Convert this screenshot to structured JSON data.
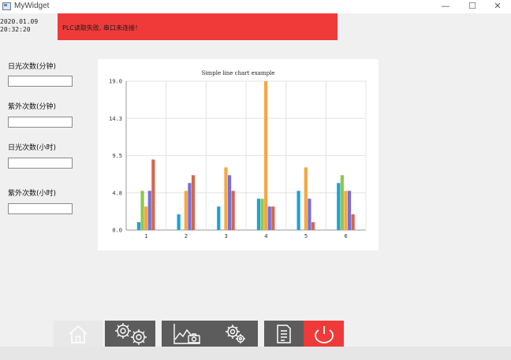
{
  "window": {
    "title": "MyWidget",
    "minimize_glyph": "—",
    "maximize_glyph": "☐",
    "close_glyph": "✕"
  },
  "clock": {
    "date": "2020.01.09",
    "time": "20:32:20"
  },
  "alert": {
    "message": "PLC读取失败, 串口未连接！",
    "color": "#f03a3a"
  },
  "fields": [
    {
      "label": "日光次数(分钟)",
      "value": ""
    },
    {
      "label": "紫外次数(分钟)",
      "value": ""
    },
    {
      "label": "日光次数(小时)",
      "value": ""
    },
    {
      "label": "紫外次数(小时)",
      "value": ""
    }
  ],
  "chart_data": {
    "type": "bar",
    "title": "Simple line chart example",
    "categories": [
      "1",
      "2",
      "3",
      "4",
      "5",
      "6"
    ],
    "ylim": [
      0,
      19
    ],
    "yticks": [
      "0.0",
      "4.8",
      "9.5",
      "14.3",
      "19.0"
    ],
    "grid": true,
    "series": [
      {
        "color": "#1aa3d6",
        "values": [
          1,
          2,
          3,
          4,
          5,
          6
        ]
      },
      {
        "color": "#8cc84b",
        "values": [
          5,
          0,
          0,
          4,
          0,
          7
        ]
      },
      {
        "color": "#f5a742",
        "values": [
          3,
          5,
          8,
          19,
          8,
          5
        ]
      },
      {
        "color": "#7b6fd0",
        "values": [
          5,
          6,
          7,
          3,
          4,
          5
        ]
      },
      {
        "color": "#d4674f",
        "values": [
          9,
          7,
          5,
          3,
          1,
          2
        ]
      }
    ]
  },
  "toolbar": {
    "buttons": [
      {
        "name": "home-button",
        "icon": "home-icon",
        "bg": "#e8e8e8",
        "active": true
      },
      {
        "name": "settings-group-button",
        "icon": "gears-icon",
        "bg": "#5c5c5c",
        "active": false
      },
      {
        "name": "chart-camera-button",
        "icon": "chart-camera-icon",
        "bg": "#5c5c5c",
        "active": false
      },
      {
        "name": "config-button",
        "icon": "cog-icon",
        "bg": "#5c5c5c",
        "active": false
      },
      {
        "name": "document-button",
        "icon": "document-icon",
        "bg": "#5c5c5c",
        "active": false
      },
      {
        "name": "power-button",
        "icon": "power-icon",
        "bg": "#f03a3a",
        "active": false
      }
    ]
  }
}
